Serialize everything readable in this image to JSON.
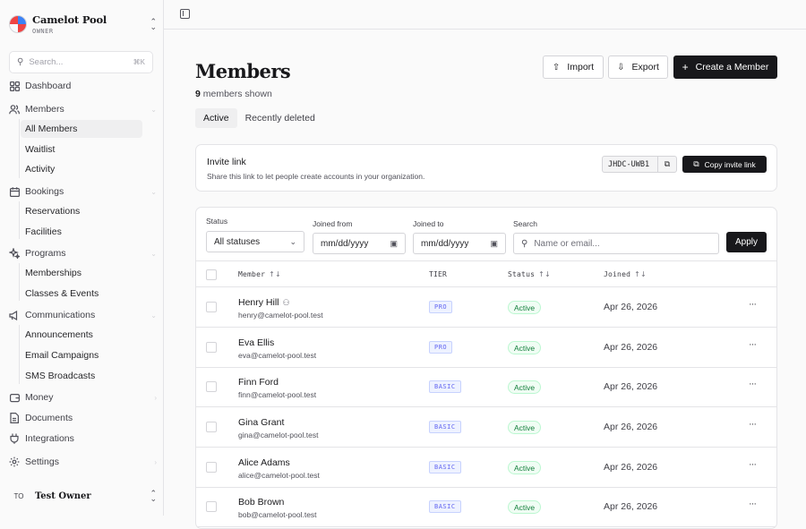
{
  "sidebar": {
    "org_name": "Camelot Pool",
    "org_role": "OWNER",
    "search_placeholder": "Search...",
    "search_shortcut": "⌘K",
    "items": [
      {
        "label": "Dashboard",
        "icon": "grid-icon"
      },
      {
        "label": "Members",
        "icon": "users-icon",
        "children": [
          "All Members",
          "Waitlist",
          "Activity"
        ]
      },
      {
        "label": "Bookings",
        "icon": "calendar-icon",
        "children": [
          "Reservations",
          "Facilities"
        ]
      },
      {
        "label": "Programs",
        "icon": "sparkle-icon",
        "children": [
          "Memberships",
          "Classes & Events"
        ]
      },
      {
        "label": "Communications",
        "icon": "megaphone-icon",
        "children": [
          "Announcements",
          "Email Campaigns",
          "SMS Broadcasts"
        ]
      },
      {
        "label": "Money",
        "icon": "wallet-icon"
      },
      {
        "label": "Documents",
        "icon": "file-icon"
      },
      {
        "label": "Integrations",
        "icon": "plug-icon"
      },
      {
        "label": "Settings",
        "icon": "gear-icon"
      }
    ],
    "active_item": "All Members",
    "user_initials": "TO",
    "user_name": "Test Owner"
  },
  "header": {
    "title": "Members",
    "count_number": "9",
    "count_text": " members shown",
    "import_label": "Import",
    "export_label": "Export",
    "create_label": "Create a Member"
  },
  "tabs": [
    "Active",
    "Recently deleted"
  ],
  "invite": {
    "title": "Invite link",
    "description": "Share this link to let people create accounts in your organization.",
    "code": "JHDC-UWB1",
    "copy_label": "Copy invite link"
  },
  "filters": {
    "status_label": "Status",
    "status_value": "All statuses",
    "joined_from_label": "Joined from",
    "joined_from_placeholder": "mm/dd/yyyy",
    "joined_to_label": "Joined to",
    "joined_to_placeholder": "mm/dd/yyyy",
    "search_label": "Search",
    "search_placeholder": "Name or email...",
    "apply_label": "Apply"
  },
  "table": {
    "columns": [
      "Member",
      "TIER",
      "Status",
      "Joined"
    ],
    "rows": [
      {
        "name": "Henry Hill",
        "email": "henry@camelot-pool.test",
        "tier": "PRO",
        "status": "Active",
        "joined": "Apr 26, 2026",
        "group": true
      },
      {
        "name": "Eva Ellis",
        "email": "eva@camelot-pool.test",
        "tier": "PRO",
        "status": "Active",
        "joined": "Apr 26, 2026"
      },
      {
        "name": "Finn Ford",
        "email": "finn@camelot-pool.test",
        "tier": "BASIC",
        "status": "Active",
        "joined": "Apr 26, 2026"
      },
      {
        "name": "Gina Grant",
        "email": "gina@camelot-pool.test",
        "tier": "BASIC",
        "status": "Active",
        "joined": "Apr 26, 2026"
      },
      {
        "name": "Alice Adams",
        "email": "alice@camelot-pool.test",
        "tier": "BASIC",
        "status": "Active",
        "joined": "Apr 26, 2026"
      },
      {
        "name": "Bob Brown",
        "email": "bob@camelot-pool.test",
        "tier": "BASIC",
        "status": "Active",
        "joined": "Apr 26, 2026"
      }
    ]
  }
}
